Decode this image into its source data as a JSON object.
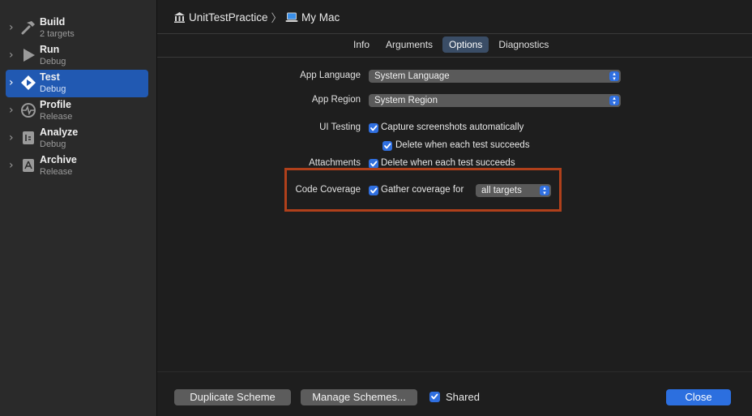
{
  "sidebar": {
    "items": [
      {
        "title": "Build",
        "subtitle": "2 targets",
        "icon": "hammer-icon"
      },
      {
        "title": "Run",
        "subtitle": "Debug",
        "icon": "play-icon"
      },
      {
        "title": "Test",
        "subtitle": "Debug",
        "icon": "test-diamond-icon",
        "selected": true
      },
      {
        "title": "Profile",
        "subtitle": "Release",
        "icon": "waveform-icon"
      },
      {
        "title": "Analyze",
        "subtitle": "Debug",
        "icon": "analyze-icon"
      },
      {
        "title": "Archive",
        "subtitle": "Release",
        "icon": "archive-icon"
      }
    ]
  },
  "breadcrumb": {
    "project": "UnitTestPractice",
    "destination": "My Mac"
  },
  "tabs": [
    "Info",
    "Arguments",
    "Options",
    "Diagnostics"
  ],
  "active_tab": "Options",
  "options": {
    "app_language": {
      "label": "App Language",
      "value": "System Language"
    },
    "app_region": {
      "label": "App Region",
      "value": "System Region"
    },
    "ui_testing": {
      "label": "UI Testing",
      "capture": "Capture screenshots automatically",
      "delete": "Delete when each test succeeds"
    },
    "attachments": {
      "label": "Attachments",
      "delete": "Delete when each test succeeds"
    },
    "code_coverage": {
      "label": "Code Coverage",
      "gather": "Gather coverage for",
      "targets": "all targets"
    }
  },
  "footer": {
    "duplicate": "Duplicate Scheme",
    "manage": "Manage Schemes...",
    "shared": "Shared",
    "close": "Close"
  },
  "colors": {
    "selection": "#2159b2",
    "accent": "#2f6fe0",
    "highlight_box": "#b0401b"
  }
}
